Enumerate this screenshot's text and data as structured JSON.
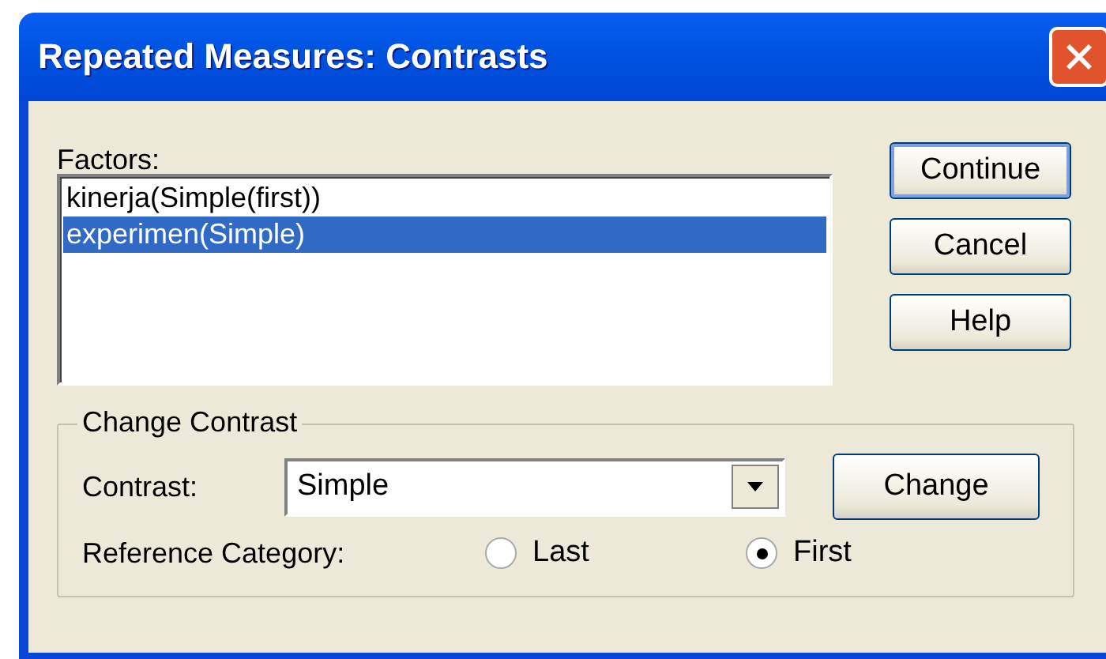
{
  "window": {
    "title": "Repeated Measures: Contrasts"
  },
  "factors": {
    "label": "Factors:",
    "items": [
      {
        "text": "kinerja(Simple(first))",
        "selected": false
      },
      {
        "text": "experimen(Simple)",
        "selected": true
      }
    ]
  },
  "buttons": [
    {
      "label": "Continue",
      "default": true
    },
    {
      "label": "Cancel",
      "default": false
    },
    {
      "label": "Help",
      "default": false
    }
  ],
  "change_contrast": {
    "title": "Change Contrast",
    "contrast_label": "Contrast:",
    "contrast_value": "Simple",
    "change_button": "Change",
    "reference_label": "Reference Category:",
    "options": [
      {
        "label": "Last",
        "selected": false
      },
      {
        "label": "First",
        "selected": true
      }
    ]
  }
}
